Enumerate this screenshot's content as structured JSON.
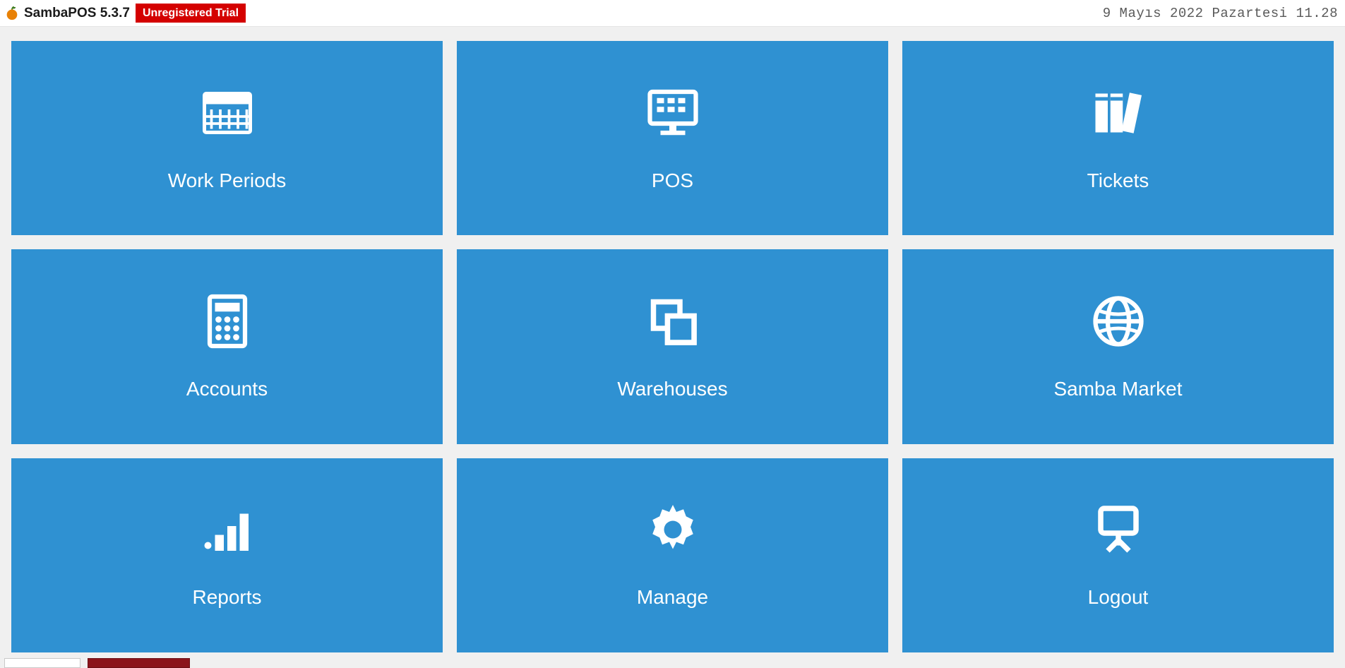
{
  "header": {
    "app_title": "SambaPOS 5.3.7",
    "trial_badge": "Unregistered Trial",
    "datetime": "9 Mayıs 2022 Pazartesi 11.28"
  },
  "tiles": [
    {
      "name": "work-periods",
      "label": "Work Periods",
      "icon": "calendar"
    },
    {
      "name": "pos",
      "label": "POS",
      "icon": "monitor"
    },
    {
      "name": "tickets",
      "label": "Tickets",
      "icon": "books"
    },
    {
      "name": "accounts",
      "label": "Accounts",
      "icon": "calculator"
    },
    {
      "name": "warehouses",
      "label": "Warehouses",
      "icon": "copy"
    },
    {
      "name": "samba-market",
      "label": "Samba Market",
      "icon": "globe"
    },
    {
      "name": "reports",
      "label": "Reports",
      "icon": "bars"
    },
    {
      "name": "manage",
      "label": "Manage",
      "icon": "gear"
    },
    {
      "name": "logout",
      "label": "Logout",
      "icon": "logout"
    }
  ]
}
